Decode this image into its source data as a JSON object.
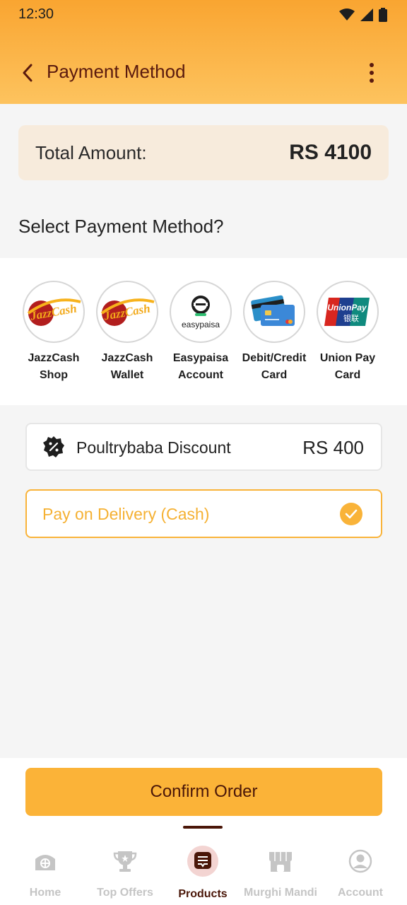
{
  "status_bar": {
    "time": "12:30"
  },
  "header": {
    "title": "Payment Method"
  },
  "total": {
    "label": "Total Amount:",
    "value": "RS 4100"
  },
  "section": {
    "title": "Select Payment Method?"
  },
  "payment_methods": [
    {
      "line1": "JazzCash",
      "line2": "Shop",
      "icon": "jazzcash-logo",
      "logo_text": "JazzCash"
    },
    {
      "line1": "JazzCash",
      "line2": "Wallet",
      "icon": "jazzcash-logo",
      "logo_text": "JazzCash"
    },
    {
      "line1": "Easypaisa",
      "line2": "Account",
      "icon": "easypaisa-logo",
      "logo_text": "easypaisa"
    },
    {
      "line1": "Debit/Credit",
      "line2": "Card",
      "icon": "credit-card-logo"
    },
    {
      "line1": "Union Pay",
      "line2": "Card",
      "icon": "unionpay-logo",
      "logo_text": "UnionPay",
      "logo_subtext": "银联"
    }
  ],
  "discount": {
    "label": "Poultrybaba Discount",
    "value": "RS 400",
    "icon": "discount-badge-icon"
  },
  "cash_option": {
    "label": "Pay on Delivery (Cash)",
    "selected": true
  },
  "confirm_button": {
    "label": "Confirm Order"
  },
  "bottom_nav": {
    "items": [
      {
        "label": "Home",
        "icon": "home-icon",
        "active": false
      },
      {
        "label": "Top Offers",
        "icon": "trophy-icon",
        "active": false
      },
      {
        "label": "Products",
        "icon": "products-icon",
        "active": true
      },
      {
        "label": "Murghi Mandi",
        "icon": "shop-icon",
        "active": false
      },
      {
        "label": "Account",
        "icon": "account-icon",
        "active": false
      }
    ]
  },
  "colors": {
    "accent": "#fbb338",
    "brand_dark": "#4a1608",
    "header_gradient_top": "#f9a531",
    "header_gradient_bottom": "#fdc35e"
  }
}
